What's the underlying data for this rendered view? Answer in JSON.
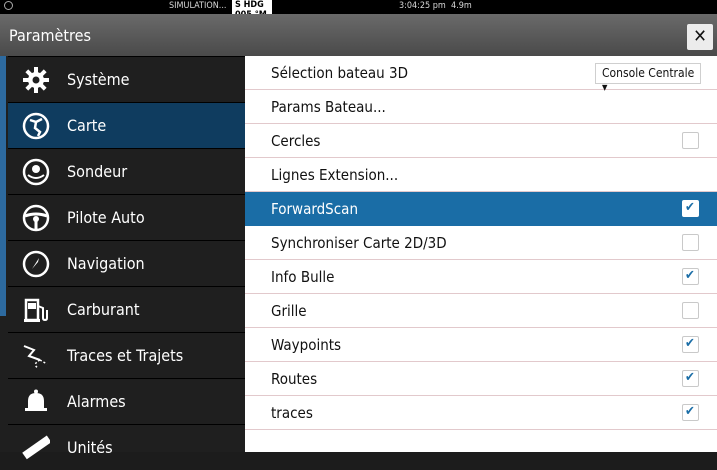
{
  "status_bar": {
    "simulation": "SIMULATION...",
    "heading": "S HDG 005 °M",
    "time": "3:04:25 pm",
    "distance": "4.9m"
  },
  "title_bar": {
    "title": "Paramètres",
    "close_label": "✕"
  },
  "sidebar": {
    "items": [
      {
        "label": "Système",
        "icon": "gear-icon",
        "selected": false
      },
      {
        "label": "Carte",
        "icon": "chart-icon",
        "selected": true
      },
      {
        "label": "Sondeur",
        "icon": "sonar-icon",
        "selected": false
      },
      {
        "label": "Pilote Auto",
        "icon": "steering-wheel-icon",
        "selected": false
      },
      {
        "label": "Navigation",
        "icon": "compass-icon",
        "selected": false
      },
      {
        "label": "Carburant",
        "icon": "fuel-pump-icon",
        "selected": false
      },
      {
        "label": "Traces et Trajets",
        "icon": "track-icon",
        "selected": false
      },
      {
        "label": "Alarmes",
        "icon": "bell-icon",
        "selected": false
      },
      {
        "label": "Unités",
        "icon": "ruler-icon",
        "selected": false
      }
    ]
  },
  "settings": {
    "rows": [
      {
        "label": "Sélection bateau 3D",
        "control": "dropdown",
        "value": "Console Centrale ▾"
      },
      {
        "label": "Params Bateau...",
        "control": "none"
      },
      {
        "label": "Cercles",
        "control": "checkbox",
        "checked": false
      },
      {
        "label": "Lignes Extension...",
        "control": "none"
      },
      {
        "label": "ForwardScan",
        "control": "checkbox",
        "checked": true,
        "selected": true
      },
      {
        "label": "Synchroniser Carte 2D/3D",
        "control": "checkbox",
        "checked": false
      },
      {
        "label": "Info Bulle",
        "control": "checkbox",
        "checked": true
      },
      {
        "label": "Grille",
        "control": "checkbox",
        "checked": false
      },
      {
        "label": "Waypoints",
        "control": "checkbox",
        "checked": true
      },
      {
        "label": "Routes",
        "control": "checkbox",
        "checked": true
      },
      {
        "label": "traces",
        "control": "checkbox",
        "checked": true
      }
    ]
  },
  "colors": {
    "accent": "#1a6da6",
    "sidebar_selected": "#0f3c5f"
  }
}
